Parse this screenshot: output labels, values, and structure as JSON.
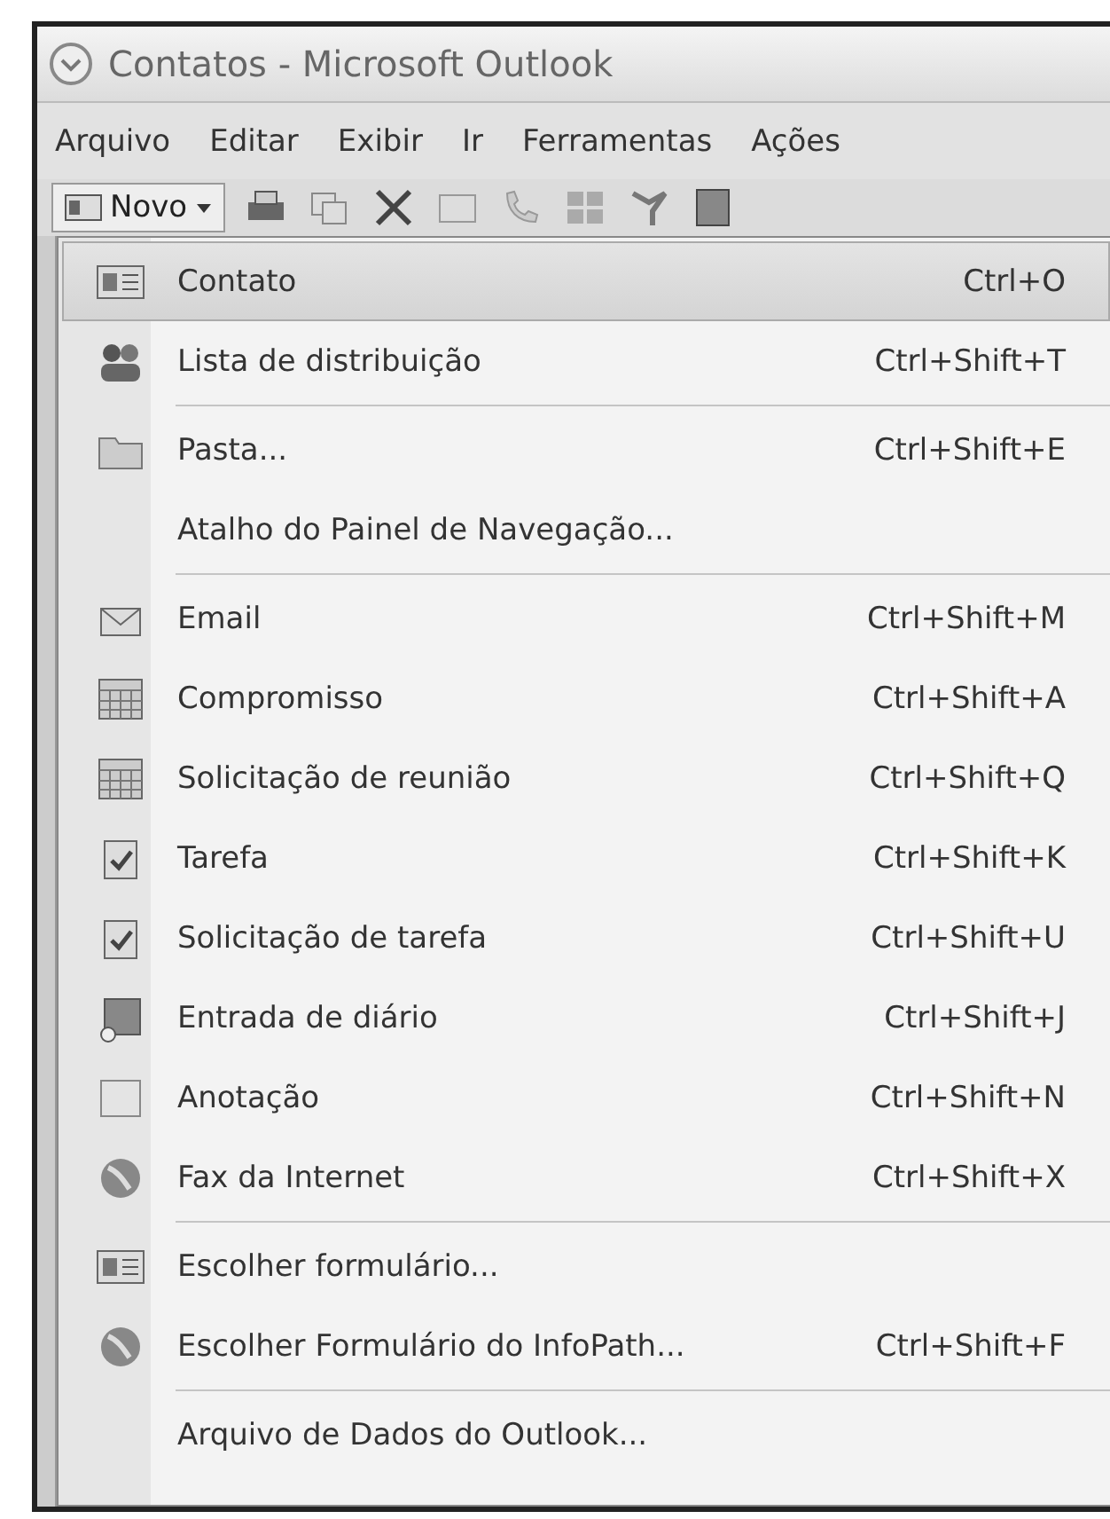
{
  "window": {
    "title": "Contatos - Microsoft Outlook"
  },
  "menubar": [
    "Arquivo",
    "Editar",
    "Exibir",
    "Ir",
    "Ferramentas",
    "Ações"
  ],
  "toolbar": {
    "new_button": "Novo"
  },
  "menu": {
    "groups": [
      [
        {
          "label": "Contato",
          "shortcut": "Ctrl+O",
          "kind": "card",
          "selected": true
        },
        {
          "label": "Lista de distribuição",
          "shortcut": "Ctrl+Shift+T",
          "kind": "people",
          "selected": false
        }
      ],
      [
        {
          "label": "Pasta...",
          "shortcut": "Ctrl+Shift+E",
          "kind": "folder",
          "selected": false
        },
        {
          "label": "Atalho do Painel de Navegação...",
          "kind": "plain",
          "selected": false
        }
      ],
      [
        {
          "label": "Email",
          "shortcut": "Ctrl+Shift+M",
          "kind": "mail",
          "selected": false
        },
        {
          "label": "Compromisso",
          "shortcut": "Ctrl+Shift+A",
          "kind": "calendar",
          "selected": false
        },
        {
          "label": "Solicitação de reunião",
          "shortcut": "Ctrl+Shift+Q",
          "kind": "calendar",
          "selected": false
        },
        {
          "label": "Tarefa",
          "shortcut": "Ctrl+Shift+K",
          "kind": "task",
          "selected": false
        },
        {
          "label": "Solicitação de tarefa",
          "shortcut": "Ctrl+Shift+U",
          "kind": "task",
          "selected": false
        },
        {
          "label": "Entrada de diário",
          "shortcut": "Ctrl+Shift+J",
          "kind": "journal",
          "selected": false
        },
        {
          "label": "Anotação",
          "shortcut": "Ctrl+Shift+N",
          "kind": "note",
          "selected": false
        },
        {
          "label": "Fax da Internet",
          "shortcut": "Ctrl+Shift+X",
          "kind": "globe",
          "selected": false
        }
      ],
      [
        {
          "label": "Escolher formulário...",
          "kind": "card",
          "selected": false
        },
        {
          "label": "Escolher Formulário do InfoPath...",
          "shortcut": "Ctrl+Shift+F",
          "kind": "globe",
          "selected": false
        }
      ],
      [
        {
          "label": "Arquivo de Dados do Outlook...",
          "kind": "plain",
          "selected": false
        }
      ]
    ]
  }
}
